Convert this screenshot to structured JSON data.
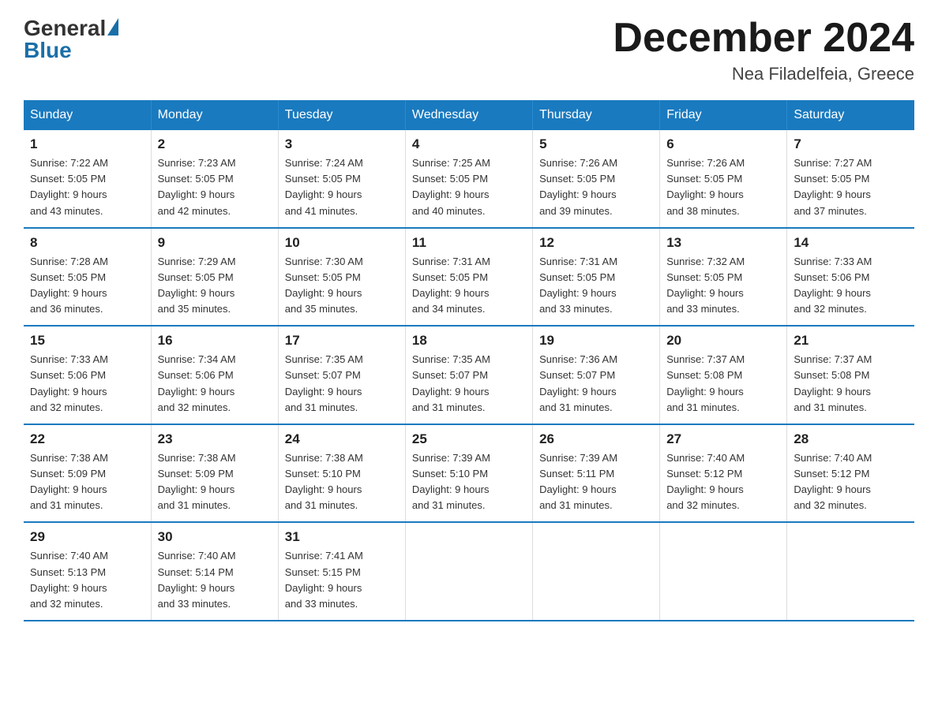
{
  "header": {
    "logo_general": "General",
    "logo_blue": "Blue",
    "month_title": "December 2024",
    "location": "Nea Filadelfeia, Greece"
  },
  "weekdays": [
    "Sunday",
    "Monday",
    "Tuesday",
    "Wednesday",
    "Thursday",
    "Friday",
    "Saturday"
  ],
  "weeks": [
    [
      {
        "day": "1",
        "sunrise": "7:22 AM",
        "sunset": "5:05 PM",
        "daylight": "9 hours and 43 minutes."
      },
      {
        "day": "2",
        "sunrise": "7:23 AM",
        "sunset": "5:05 PM",
        "daylight": "9 hours and 42 minutes."
      },
      {
        "day": "3",
        "sunrise": "7:24 AM",
        "sunset": "5:05 PM",
        "daylight": "9 hours and 41 minutes."
      },
      {
        "day": "4",
        "sunrise": "7:25 AM",
        "sunset": "5:05 PM",
        "daylight": "9 hours and 40 minutes."
      },
      {
        "day": "5",
        "sunrise": "7:26 AM",
        "sunset": "5:05 PM",
        "daylight": "9 hours and 39 minutes."
      },
      {
        "day": "6",
        "sunrise": "7:26 AM",
        "sunset": "5:05 PM",
        "daylight": "9 hours and 38 minutes."
      },
      {
        "day": "7",
        "sunrise": "7:27 AM",
        "sunset": "5:05 PM",
        "daylight": "9 hours and 37 minutes."
      }
    ],
    [
      {
        "day": "8",
        "sunrise": "7:28 AM",
        "sunset": "5:05 PM",
        "daylight": "9 hours and 36 minutes."
      },
      {
        "day": "9",
        "sunrise": "7:29 AM",
        "sunset": "5:05 PM",
        "daylight": "9 hours and 35 minutes."
      },
      {
        "day": "10",
        "sunrise": "7:30 AM",
        "sunset": "5:05 PM",
        "daylight": "9 hours and 35 minutes."
      },
      {
        "day": "11",
        "sunrise": "7:31 AM",
        "sunset": "5:05 PM",
        "daylight": "9 hours and 34 minutes."
      },
      {
        "day": "12",
        "sunrise": "7:31 AM",
        "sunset": "5:05 PM",
        "daylight": "9 hours and 33 minutes."
      },
      {
        "day": "13",
        "sunrise": "7:32 AM",
        "sunset": "5:05 PM",
        "daylight": "9 hours and 33 minutes."
      },
      {
        "day": "14",
        "sunrise": "7:33 AM",
        "sunset": "5:06 PM",
        "daylight": "9 hours and 32 minutes."
      }
    ],
    [
      {
        "day": "15",
        "sunrise": "7:33 AM",
        "sunset": "5:06 PM",
        "daylight": "9 hours and 32 minutes."
      },
      {
        "day": "16",
        "sunrise": "7:34 AM",
        "sunset": "5:06 PM",
        "daylight": "9 hours and 32 minutes."
      },
      {
        "day": "17",
        "sunrise": "7:35 AM",
        "sunset": "5:07 PM",
        "daylight": "9 hours and 31 minutes."
      },
      {
        "day": "18",
        "sunrise": "7:35 AM",
        "sunset": "5:07 PM",
        "daylight": "9 hours and 31 minutes."
      },
      {
        "day": "19",
        "sunrise": "7:36 AM",
        "sunset": "5:07 PM",
        "daylight": "9 hours and 31 minutes."
      },
      {
        "day": "20",
        "sunrise": "7:37 AM",
        "sunset": "5:08 PM",
        "daylight": "9 hours and 31 minutes."
      },
      {
        "day": "21",
        "sunrise": "7:37 AM",
        "sunset": "5:08 PM",
        "daylight": "9 hours and 31 minutes."
      }
    ],
    [
      {
        "day": "22",
        "sunrise": "7:38 AM",
        "sunset": "5:09 PM",
        "daylight": "9 hours and 31 minutes."
      },
      {
        "day": "23",
        "sunrise": "7:38 AM",
        "sunset": "5:09 PM",
        "daylight": "9 hours and 31 minutes."
      },
      {
        "day": "24",
        "sunrise": "7:38 AM",
        "sunset": "5:10 PM",
        "daylight": "9 hours and 31 minutes."
      },
      {
        "day": "25",
        "sunrise": "7:39 AM",
        "sunset": "5:10 PM",
        "daylight": "9 hours and 31 minutes."
      },
      {
        "day": "26",
        "sunrise": "7:39 AM",
        "sunset": "5:11 PM",
        "daylight": "9 hours and 31 minutes."
      },
      {
        "day": "27",
        "sunrise": "7:40 AM",
        "sunset": "5:12 PM",
        "daylight": "9 hours and 32 minutes."
      },
      {
        "day": "28",
        "sunrise": "7:40 AM",
        "sunset": "5:12 PM",
        "daylight": "9 hours and 32 minutes."
      }
    ],
    [
      {
        "day": "29",
        "sunrise": "7:40 AM",
        "sunset": "5:13 PM",
        "daylight": "9 hours and 32 minutes."
      },
      {
        "day": "30",
        "sunrise": "7:40 AM",
        "sunset": "5:14 PM",
        "daylight": "9 hours and 33 minutes."
      },
      {
        "day": "31",
        "sunrise": "7:41 AM",
        "sunset": "5:15 PM",
        "daylight": "9 hours and 33 minutes."
      },
      null,
      null,
      null,
      null
    ]
  ],
  "labels": {
    "sunrise": "Sunrise:",
    "sunset": "Sunset:",
    "daylight": "Daylight:"
  }
}
